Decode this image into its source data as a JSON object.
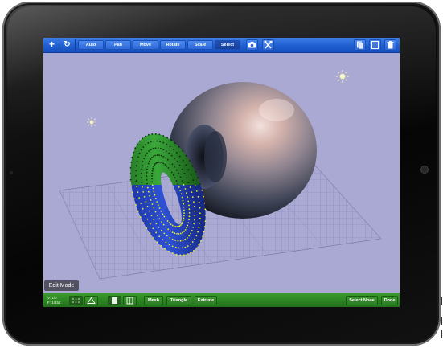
{
  "toolbar": {
    "modes": [
      {
        "label": "Auto",
        "active": false
      },
      {
        "label": "Pan",
        "active": false
      },
      {
        "label": "Move",
        "active": false
      },
      {
        "label": "Rotate",
        "active": false
      },
      {
        "label": "Scale",
        "active": false
      },
      {
        "label": "Select",
        "active": true
      }
    ],
    "left_icons": [
      "add-icon",
      "refresh-icon"
    ],
    "right_icons": [
      "camera-icon",
      "tools-icon",
      "copy-icon",
      "split-view-icon",
      "trash-icon"
    ]
  },
  "viewport": {
    "background": "#a9a9d4",
    "objects": [
      "torus",
      "sphere",
      "grid-floor",
      "light-1",
      "light-2"
    ],
    "light_icon": "sun-icon"
  },
  "status": {
    "mode_label": "Edit Mode",
    "info_line1": "V: 1/0",
    "info_line2": "F: 1/152"
  },
  "bottombar": {
    "mesh_label": "Mesh",
    "triangle_label": "Triangle",
    "extrude_label": "Extrude",
    "select_none_label": "Select None",
    "done_label": "Done",
    "tool_icons": [
      "vertex-select-icon",
      "triangle-select-icon",
      "face-solid-icon",
      "face-page-icon"
    ]
  },
  "colors": {
    "toolbar_blue": "#2a66d6",
    "bottombar_green": "#2a8020",
    "torus_green": "#2f9a2e",
    "torus_blue": "#2a46c8",
    "point_yellow": "#f0f020"
  }
}
